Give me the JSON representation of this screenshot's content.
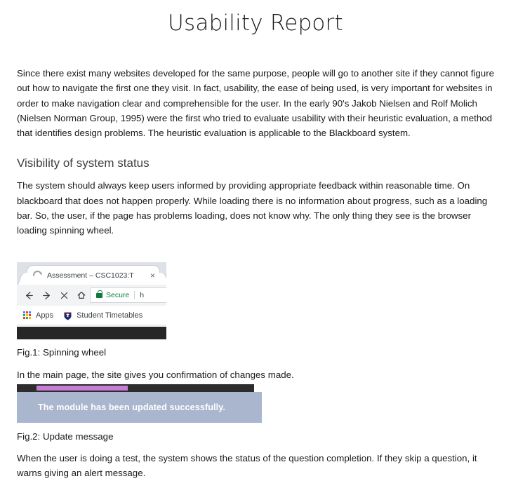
{
  "document": {
    "title": "Usability Report"
  },
  "intro": {
    "paragraph": "Since there exist many websites developed for the same purpose, people will go to another site if they cannot figure out how to navigate the first one they visit. In fact, usability, the ease of being used, is very important for websites in order to make navigation clear and comprehensible for the user. In the early 90's Jakob Nielsen and Rolf Molich (Nielsen Norman Group, 1995) were the first who tried to evaluate usability with their heuristic evaluation, a method that identifies design problems. The heuristic evaluation is applicable to the Blackboard system."
  },
  "section": {
    "heading": "Visibility of system status",
    "paragraph": "The system should always keep users informed by providing appropriate feedback within reasonable time. On blackboard that does not happen properly. While loading there is no information about progress, such as a loading bar. So, the user, if the page has problems loading, does not know why. The only thing they see is the browser loading spinning wheel."
  },
  "figure1": {
    "caption": "Fig.1: Spinning wheel",
    "browser": {
      "tab_title": "Assessment – CSC1023:T",
      "tab_close_label": "×",
      "back_icon": "back-arrow-icon",
      "forward_icon": "forward-arrow-icon",
      "stop_icon": "stop-x-icon",
      "home_icon": "home-icon",
      "security_label": "Secure",
      "url_text": "h",
      "apps_label": "Apps",
      "bookmark_label": "Student Timetables",
      "spinner_icon": "loading-spinner-icon",
      "lock_icon": "lock-icon",
      "apps_icon": "apps-grid-icon",
      "crest_icon": "university-crest-icon"
    }
  },
  "mid_text": {
    "paragraph": "In the main page, the site gives you confirmation of changes made."
  },
  "figure2": {
    "caption": "Fig.2: Update message",
    "banner_message": "The module has been updated successfully.",
    "colors": {
      "bar_dark": "#2d2d2d",
      "progress_purple": "#c87cd8",
      "banner_bg": "#a9b6cd",
      "banner_text": "#ffffff"
    }
  },
  "closing_text": {
    "paragraph": "When the user is doing a test, the system shows the status of the question completion. If they skip a question, it warns giving an alert message."
  }
}
